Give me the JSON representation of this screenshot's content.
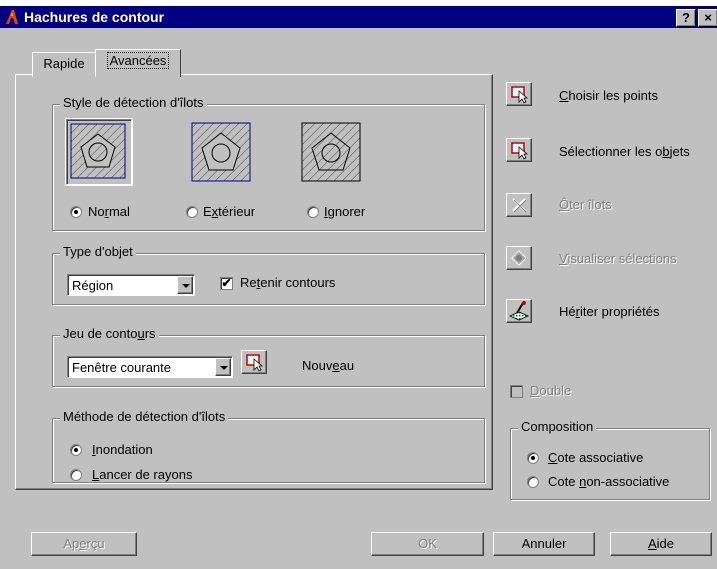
{
  "titlebar": {
    "title": "Hachures de contour",
    "help_label": "?",
    "close_label": "×"
  },
  "tabs": [
    {
      "label": "Rapide"
    },
    {
      "label": "Avancées"
    }
  ],
  "island_style": {
    "label": "Style de détection d'îlots",
    "options": [
      {
        "pre": "No",
        "u": "r",
        "post": "mal",
        "selected": true
      },
      {
        "pre": "E",
        "u": "x",
        "post": "térieur",
        "selected": false
      },
      {
        "pre": "",
        "u": "I",
        "post": "gnorer",
        "selected": false
      }
    ]
  },
  "object_type": {
    "label": "Type d'objet",
    "value": "Région",
    "retain": {
      "pre": "Re",
      "u": "t",
      "post": "enir contours",
      "checked": true
    }
  },
  "boundary_set": {
    "label_pre": "Jeu de conto",
    "label_u": "u",
    "label_post": "rs",
    "value": "Fenêtre courante",
    "new_pre": "Nouv",
    "new_u": "e",
    "new_post": "au"
  },
  "detection_method": {
    "label": "Méthode de détection d'îlots",
    "options": [
      {
        "pre": "",
        "u": "I",
        "post": "nondation",
        "selected": true
      },
      {
        "pre": "",
        "u": "L",
        "post": "ancer de rayons",
        "selected": false
      }
    ]
  },
  "actions": [
    {
      "pre": "",
      "u": "C",
      "post": "hoisir les points",
      "enabled": true
    },
    {
      "pre": "Sélectionner les o",
      "u": "b",
      "post": "jets",
      "enabled": true
    },
    {
      "pre": "",
      "u": "Ô",
      "post": "ter îlots",
      "enabled": false
    },
    {
      "pre": "",
      "u": "V",
      "post": "isualiser sélections",
      "enabled": false
    },
    {
      "pre": "Hé",
      "u": "r",
      "post": "iter propriétés",
      "enabled": true
    }
  ],
  "double": {
    "pre": "",
    "u": "D",
    "post": "ouble",
    "checked": false
  },
  "composition": {
    "label": "Composition",
    "options": [
      {
        "pre": "",
        "u": "C",
        "post": "ote associative",
        "selected": true
      },
      {
        "pre": "Cote ",
        "u": "n",
        "post": "on-associative",
        "selected": false
      }
    ]
  },
  "buttons": {
    "preview": {
      "pre": "Ap",
      "u": "e",
      "post": "rçu"
    },
    "ok": "OK",
    "cancel": "Annuler",
    "help": {
      "pre": "",
      "u": "A",
      "post": "ide"
    }
  },
  "colors": {
    "titlebar": "#000080",
    "face": "#c0c0c0",
    "disabled": "#808080"
  }
}
